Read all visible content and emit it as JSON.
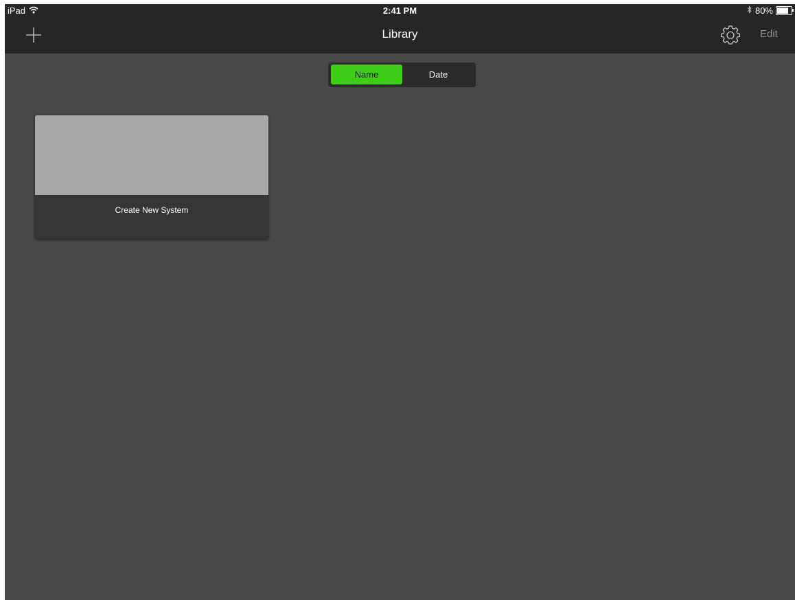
{
  "status_bar": {
    "device": "iPad",
    "time": "2:41 PM",
    "battery_percent": "80%",
    "battery_level": 0.8
  },
  "nav": {
    "title": "Library",
    "add_icon": "plus-icon",
    "settings_icon": "gear-icon",
    "edit_label": "Edit"
  },
  "sort": {
    "options": [
      "Name",
      "Date"
    ],
    "selected": "Name"
  },
  "library": {
    "items": [
      {
        "label": "Create New System"
      }
    ]
  },
  "colors": {
    "accent": "#3fce17",
    "background": "#48484a",
    "nav_background": "#262626",
    "card_footer": "#343535",
    "card_thumbnail": "#a8a9ab"
  }
}
